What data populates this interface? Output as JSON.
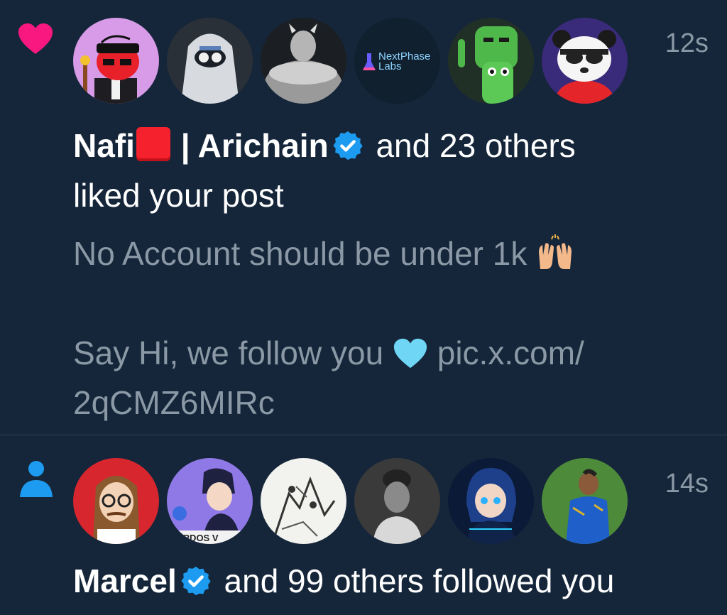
{
  "like_notification": {
    "icon": "heart-icon",
    "icon_color": "#f91880",
    "time": "12s",
    "avatars": [
      "avatar-red-character",
      "avatar-hooded-figure",
      "avatar-muscle-figure",
      "avatar-nextphase-labs",
      "avatar-green-frogs",
      "avatar-panda"
    ],
    "nextphase_logo_text_1": "NextPhase",
    "nextphase_logo_text_2": "Labs",
    "actor_name_1": "Nafi",
    "actor_name_2": "| Arichain",
    "rest": "and 23 others",
    "line2": "liked your post",
    "post_line_1": "No Account should be under 1k",
    "post_line_2": "",
    "post_line_3_text": "Say Hi, we follow you",
    "post_line_3_link": "pic.x.com/",
    "post_line_4": "2qCMZ6MIRc"
  },
  "follow_notification": {
    "icon": "person-icon",
    "icon_color": "#1d9bf0",
    "time": "14s",
    "avatars": [
      "avatar-glasses-man",
      "avatar-anime-boy",
      "avatar-sketch-art",
      "avatar-woman-bw",
      "avatar-anime-blue",
      "avatar-cricketer"
    ],
    "anime_caption": "ERDOS V",
    "actor_name": "Marcel",
    "rest": "and 99 others followed you"
  },
  "colors": {
    "background": "#15263a",
    "verified_badge": "#1d9bf0",
    "secondary_text": "#8b98a5",
    "primary_text": "#ffffff"
  }
}
